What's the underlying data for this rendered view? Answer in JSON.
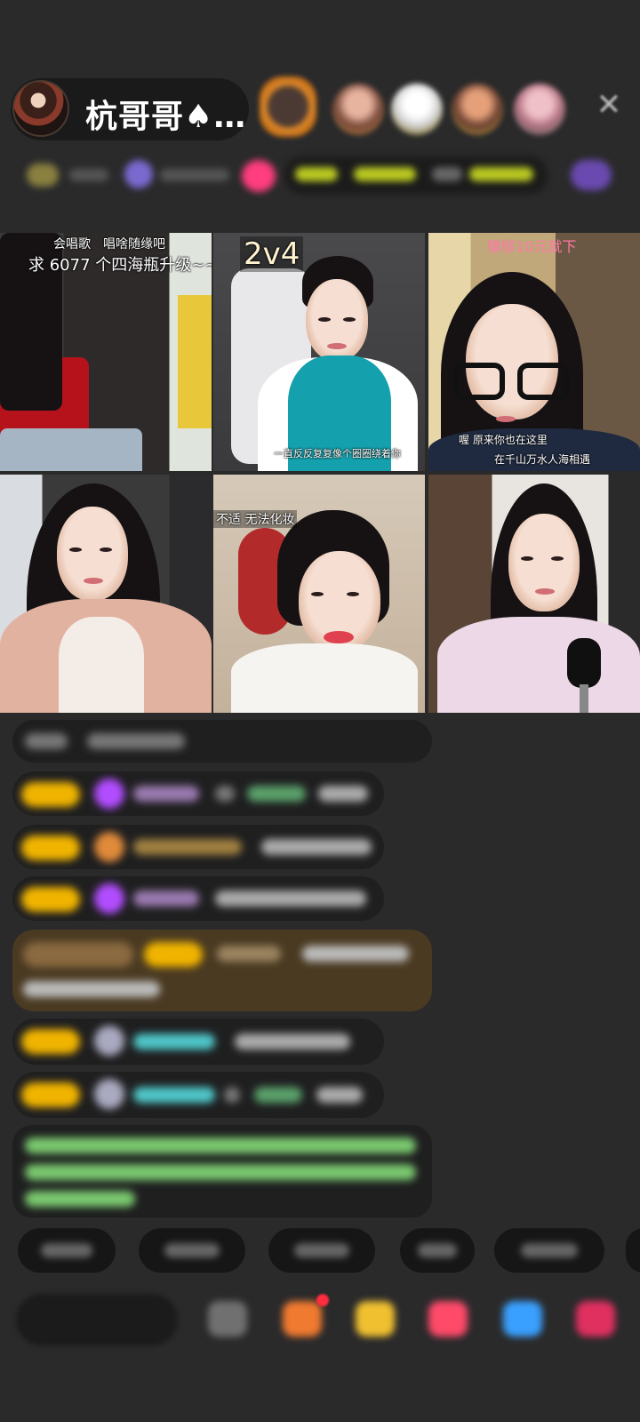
{
  "host": {
    "name": "杭哥哥♠…"
  },
  "close_icon": "close-icon",
  "video_tiles": [
    {
      "captions": [
        "会唱歌",
        "唱啥随缘吧",
        "求 6077 个四海瓶升级~~"
      ]
    },
    {
      "captions": [
        "2v4",
        "一直反反复复像个圈圈绕着你"
      ]
    },
    {
      "captions": [
        "赚够10元就下",
        "喔  原来你也在这里",
        "在千山万水人海相遇"
      ]
    },
    {
      "captions": []
    },
    {
      "captions": [
        "不适 无法化妆"
      ]
    },
    {
      "captions": []
    }
  ],
  "colors": {
    "background": "#2a2a2b",
    "chat_bubble": "#1f1f20",
    "highlight_bubble": "#4a3a22",
    "level_badge": "#f0b400",
    "gift_purple": "#b24dff",
    "username_cyan": "#4fc6c8",
    "system_green": "#7bc96f"
  },
  "bottom_icons": [
    "emoji-icon",
    "gift-box-icon",
    "treasure-icon",
    "heart-gift-icon",
    "game-icon",
    "more-apps-icon"
  ]
}
